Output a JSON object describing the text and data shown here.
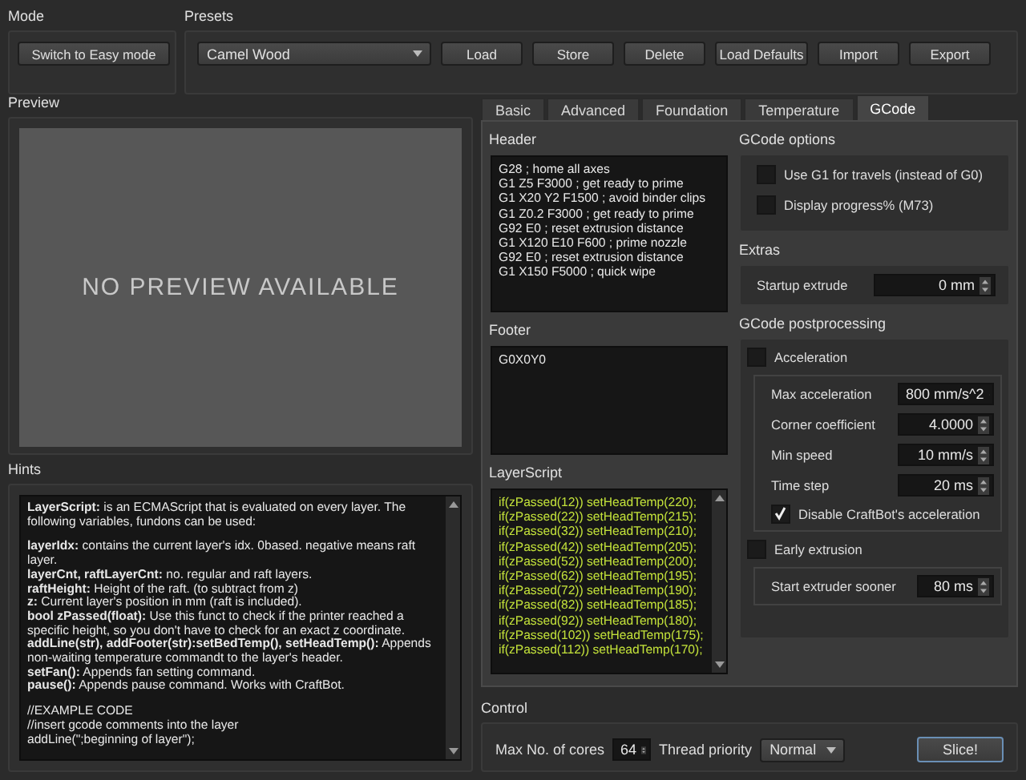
{
  "mode": {
    "title": "Mode",
    "button": "Switch to Easy mode"
  },
  "presets": {
    "title": "Presets",
    "selected_preset": "Camel Wood",
    "buttons": [
      "Load",
      "Store",
      "Delete",
      "Load Defaults",
      "Import",
      "Export"
    ]
  },
  "preview": {
    "title": "Preview",
    "message": "NO PREVIEW AVAILABLE"
  },
  "hints": {
    "title": "Hints",
    "blocks": [
      [
        "**LayerScript:** is an ECMAScript that is evaluated on every layer. The following variables, fundons can be used:"
      ],
      [
        "**layerIdx:** contains the current layer's idx. 0based. negative means raft layer.",
        "**layerCnt, raftLayerCnt:** no. regular and raft layers.",
        "**raftHeight:** Height of the raft. (to subtract from z)",
        "**z:** Current layer's position in mm (raft is included).",
        "**bool zPassed(float):** Use this funct to check if the printer reached a specific height, so you don't have to check for an exact z coordinate.",
        "**addLine(str), addFooter(str):setBedTemp(), setHeadTemp():** Appends non-waiting temperature commandt to the layer's header.",
        "**setFan():** Appends fan setting command.",
        "**pause():** Appends pause command. Works with CraftBot."
      ],
      [
        "//EXAMPLE CODE",
        "//insert gcode comments into the layer",
        "addLine(\";beginning of layer\");"
      ]
    ]
  },
  "tabs": [
    {
      "label": "Basic",
      "selected": false
    },
    {
      "label": "Advanced",
      "selected": false
    },
    {
      "label": "Foundation",
      "selected": false
    },
    {
      "label": "Temperature",
      "selected": false
    },
    {
      "label": "GCode",
      "selected": true
    }
  ],
  "gcode_tab": {
    "header": {
      "title": "Header",
      "lines": [
        "G28 ; home all axes",
        "G1 Z5 F3000 ; get ready to prime",
        "G1 X20 Y2 F1500 ; avoid binder clips",
        "G1 Z0.2 F3000 ; get ready to prime",
        "G92 E0 ; reset extrusion distance",
        "G1 X120 E10 F600 ; prime nozzle",
        "G92 E0 ; reset extrusion distance",
        "G1 X150 F5000 ; quick wipe"
      ]
    },
    "footer": {
      "title": "Footer",
      "lines": [
        "G0X0Y0"
      ]
    },
    "layer_script": {
      "title": "LayerScript",
      "lines": [
        "if(zPassed(12)) setHeadTemp(220);",
        "if(zPassed(22)) setHeadTemp(215);",
        "if(zPassed(32)) setHeadTemp(210);",
        "if(zPassed(42)) setHeadTemp(205);",
        "if(zPassed(52)) setHeadTemp(200);",
        "if(zPassed(62)) setHeadTemp(195);",
        "if(zPassed(72)) setHeadTemp(190);",
        "if(zPassed(82)) setHeadTemp(185);",
        "if(zPassed(92)) setHeadTemp(180);",
        "if(zPassed(102)) setHeadTemp(175);",
        "if(zPassed(112)) setHeadTemp(170);"
      ]
    },
    "gcode_options": {
      "title": "GCode options",
      "checkboxes": [
        {
          "label": "Use G1 for travels (instead of G0)",
          "checked": false
        },
        {
          "label": "Display progress% (M73)",
          "checked": false
        }
      ]
    },
    "extras": {
      "title": "Extras",
      "fields": [
        {
          "label": "Startup extrude",
          "value": "0 mm"
        }
      ]
    },
    "postprocessing": {
      "title": "GCode postprocessing",
      "acceleration": {
        "label": "Acceleration",
        "checked": false,
        "fields": [
          {
            "label": "Max acceleration",
            "value": "800 mm/s^2"
          },
          {
            "label": "Corner coefficient",
            "value": "4.0000"
          },
          {
            "label": "Min speed",
            "value": "10 mm/s"
          },
          {
            "label": "Time step",
            "value": "20 ms"
          }
        ],
        "option": {
          "label": "Disable CraftBot's acceleration",
          "checked": true
        }
      },
      "early_extrusion": {
        "label": "Early extrusion",
        "checked": false,
        "fields": [
          {
            "label": "Start extruder sooner",
            "value": "80 ms"
          }
        ]
      }
    }
  },
  "control": {
    "title": "Control",
    "cores": {
      "label": "Max No. of cores",
      "value": "64"
    },
    "thread_priority": {
      "label": "Thread priority",
      "value": "Normal"
    },
    "slice_button": "Slice!"
  }
}
